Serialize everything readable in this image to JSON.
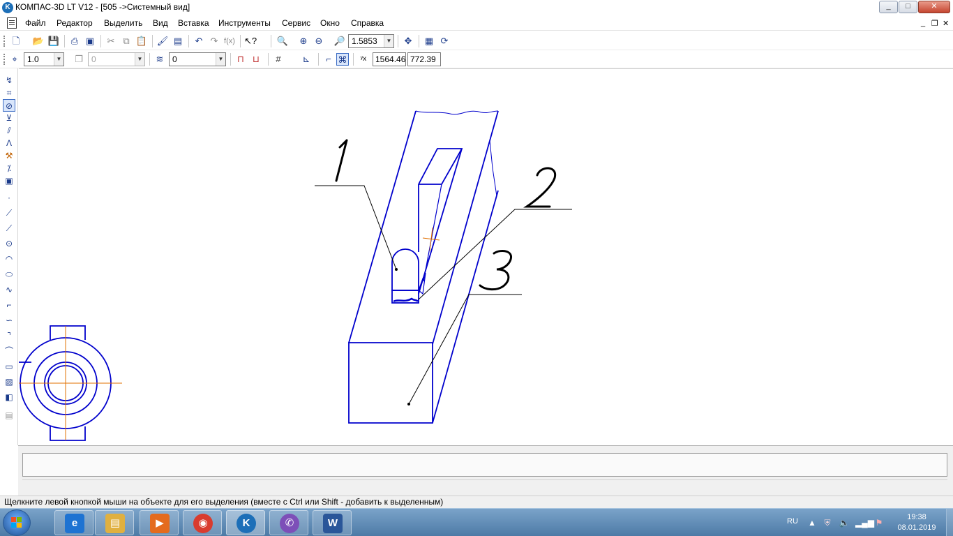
{
  "window": {
    "title": "КОМПАС-3D LT V12 - [505 ->Системный вид]",
    "app_icon_glyph": "K",
    "minimize": "_",
    "maximize": "□",
    "close": "✕"
  },
  "menu": {
    "items": [
      {
        "label": "Файл"
      },
      {
        "label": "Редактор"
      },
      {
        "label": "Выделить"
      },
      {
        "label": "Вид"
      },
      {
        "label": "Вставка"
      },
      {
        "label": "Инструменты"
      },
      {
        "label": "Сервис"
      },
      {
        "label": "Окно"
      },
      {
        "label": "Справка"
      }
    ],
    "doc_minimize": "_",
    "doc_restore": "❐",
    "doc_close": "✕"
  },
  "toolbar_standard": {
    "zoom_value": "1.5853",
    "icons": [
      "new-document-icon",
      "open-folder-icon",
      "save-icon",
      "print-preview-icon",
      "print-icon",
      "cut-icon",
      "copy-icon",
      "paste-icon",
      "format-brush-icon",
      "properties-icon",
      "undo-icon",
      "redo-icon",
      "function-icon",
      "help-cursor-icon",
      "zoom-window-icon",
      "zoom-in-icon",
      "zoom-out-icon",
      "zoom-scale-icon",
      "pan-icon",
      "refresh-icon",
      "rebuild-icon"
    ]
  },
  "toolbar_current_state": {
    "step_value": "1.0",
    "layer_value": "0",
    "style_value": "0",
    "coord_x": "1564.46",
    "coord_y": "772.39",
    "icons": [
      "cursor-step-icon",
      "layer-icon",
      "style-icon",
      "snap-magnet-icon",
      "snap-local-icon",
      "grid-icon",
      "orthogonal-icon",
      "round-icon",
      "snap-active-icon",
      "coordinates-icon"
    ]
  },
  "left_toolbar": {
    "icons": [
      "geometry-icon",
      "dimensions-icon",
      "designations-icon",
      "edit-icon",
      "parameterization-icon",
      "measure-icon",
      "select-icon",
      "fragment-icon",
      "point-icon",
      "line-icon",
      "segment-icon",
      "circle-icon",
      "arc-icon",
      "ellipse-icon",
      "spline-icon",
      "polyline-icon",
      "bezier-icon",
      "chamfer-icon",
      "fillet-icon",
      "rectangle-icon",
      "hatch-icon",
      "fill-icon",
      "macro-icon"
    ]
  },
  "drawing": {
    "callouts": [
      {
        "label": "1"
      },
      {
        "label": "2"
      },
      {
        "label": "3"
      }
    ],
    "line_color": "#0000cc",
    "axis_color": "#e07000"
  },
  "status": {
    "message": "Щелкните левой кнопкой мыши на объекте для его выделения (вместе с Ctrl или Shift - добавить к выделенным)"
  },
  "taskbar": {
    "apps": [
      {
        "name": "internet-explorer-icon",
        "glyph": "e",
        "color": "#1e73d2"
      },
      {
        "name": "file-explorer-icon",
        "glyph": "▤",
        "color": "#e0b040"
      },
      {
        "name": "media-player-icon",
        "glyph": "▶",
        "color": "#e46b1e"
      },
      {
        "name": "chrome-icon",
        "glyph": "◉",
        "color": "#d93c2f"
      },
      {
        "name": "kompas-icon",
        "glyph": "K",
        "color": "#1d6fb8"
      },
      {
        "name": "viber-icon",
        "glyph": "✆",
        "color": "#7d4fb8"
      },
      {
        "name": "word-icon",
        "glyph": "W",
        "color": "#2a5699"
      }
    ],
    "language": "RU",
    "time": "19:38",
    "date": "08.01.2019"
  }
}
